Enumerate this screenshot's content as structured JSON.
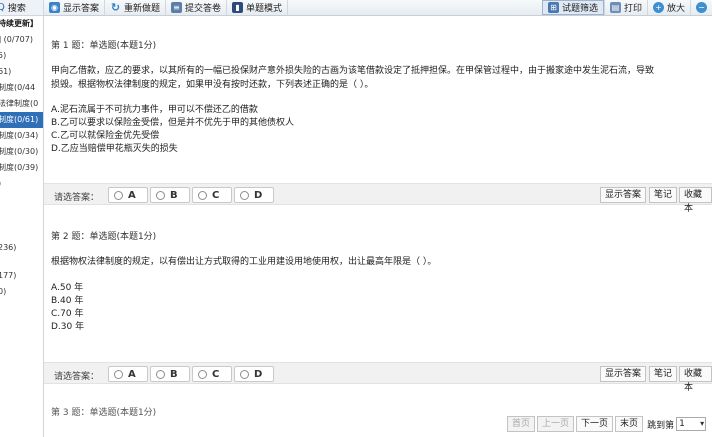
{
  "sidebar": {
    "search_label": "搜索",
    "items": [
      "持续更新】",
      "] (0/707)",
      "5)",
      "61)",
      "制度(0/44",
      "法律制度(0",
      "制度(0/61)",
      "制度(0/34)",
      "制度(0/30)",
      "制度(0/39)",
      ")",
      "236)",
      "177)",
      "0)"
    ],
    "active_index": 6
  },
  "toolbar": {
    "show_answer": "显示答案",
    "redo": "重新做题",
    "submit": "提交答卷",
    "single_mode": "单题模式",
    "filter": "试题筛选",
    "print": "打印",
    "zoom_in": "放大",
    "zoom_out_icon": "−"
  },
  "questions": [
    {
      "header": "第 1 题：单选题(本题1分)",
      "stem_line1": "甲向乙借款，应乙的要求，以其所有的一幅已投保财产意外损失险的古画为该笔借款设定了抵押担保。在甲保管过程中，由于搬家途中发生泥石流，导致",
      "stem_line2": "损毁。根据物权法律制度的规定，如果甲没有按时还款，下列表述正确的是（ ）。",
      "options": [
        "A.泥石流属于不可抗力事件，甲可以不偿还乙的借款",
        "B.乙可以要求以保险金受偿，但是并不优先于甲的其他债权人",
        "C.乙可以就保险金优先受偿",
        "D.乙应当赔偿甲花瓶灭失的损失"
      ]
    },
    {
      "header": "第 2 题：单选题(本题1分)",
      "stem_line1": "根据物权法律制度的规定，以有偿出让方式取得的工业用建设用地使用权，出让最高年限是（ ）。",
      "options": [
        "A.50 年",
        "B.40 年",
        "C.70 年",
        "D.30 年"
      ]
    },
    {
      "header": "第 3 题：单选题(本题1分)"
    }
  ],
  "answer_bar": {
    "label": "请选答案：",
    "choices": [
      "A",
      "B",
      "C",
      "D"
    ],
    "show_answer": "显示答案",
    "note": "笔记",
    "collect": "收藏本"
  },
  "pager": {
    "first": "首页",
    "prev": "上一页",
    "next": "下一页",
    "last": "末页",
    "jump_label": "跳到第",
    "page_value": "1"
  }
}
